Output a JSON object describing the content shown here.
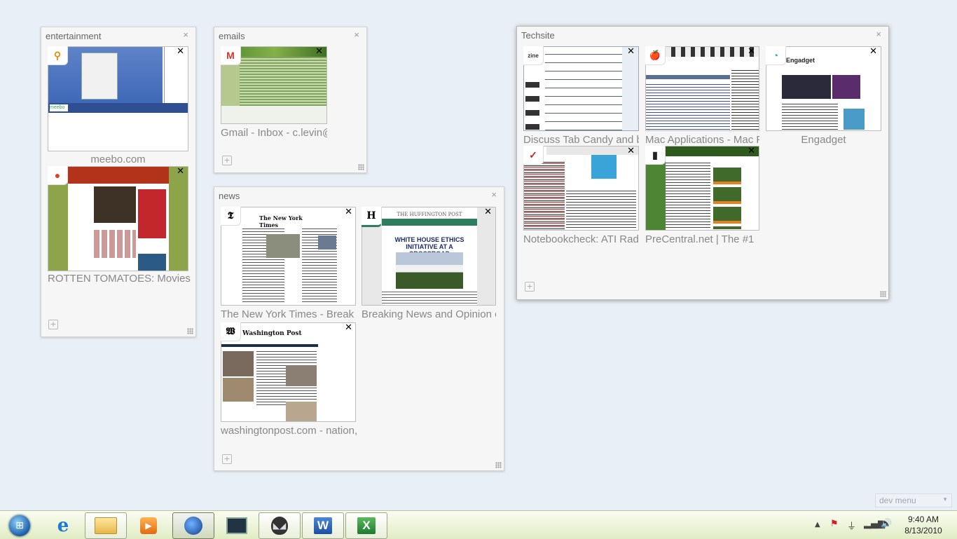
{
  "groups": {
    "entertainment": {
      "title": "entertainment",
      "tabs": [
        {
          "title": "meebo.com",
          "favicon": "meebo-icon"
        },
        {
          "title": "ROTTEN TOMATOES: Movies",
          "favicon": "tomato-icon"
        }
      ]
    },
    "emails": {
      "title": "emails",
      "tabs": [
        {
          "title": "Gmail - Inbox - c.levin@",
          "favicon": "gmail-icon",
          "fav_glyph": "M"
        }
      ]
    },
    "news": {
      "title": "news",
      "tabs": [
        {
          "title": "The New York Times - Break",
          "favicon": "nyt-icon",
          "fav_glyph": "𝕿",
          "masthead": "The New York Times"
        },
        {
          "title": "Breaking News and Opinion o",
          "favicon": "huffpost-icon",
          "fav_glyph": "H",
          "masthead": "THE HUFFINGTON POST",
          "headline": "WHITE HOUSE ETHICS INITIATIVE AT A CROSSROAD"
        },
        {
          "title": "washingtonpost.com - nation,",
          "favicon": "wapo-icon",
          "fav_glyph": "𝖂",
          "masthead": "Washington Post"
        }
      ]
    },
    "techsite": {
      "title": "Techsite",
      "tabs": [
        {
          "title": "Discuss Tab Candy and b",
          "favicon": "zine-icon",
          "fav_glyph": "zine"
        },
        {
          "title": "Mac Applications - Mac Fo",
          "favicon": "apple-icon",
          "fav_glyph": "🍎"
        },
        {
          "title": "Engadget",
          "favicon": "rss-icon",
          "fav_glyph": "◔"
        },
        {
          "title": "Notebookcheck: ATI Rad",
          "favicon": "notebookcheck-icon",
          "fav_glyph": "✓"
        },
        {
          "title": "PreCentral.net | The #1",
          "favicon": "precentral-icon",
          "fav_glyph": "▮"
        }
      ]
    }
  },
  "close_glyph": "×",
  "tab_close_glyph": "✕",
  "newtab_glyph": "+",
  "dev_menu": {
    "label": "dev menu"
  },
  "taskbar": {
    "items": [
      "Start",
      "Internet Explorer",
      "Windows Explorer",
      "Media Player",
      "Firefox Minefield",
      "System Monitor",
      "Alien App",
      "Microsoft Word",
      "Microsoft Excel"
    ]
  },
  "clock": {
    "time": "9:40 AM",
    "date": "8/13/2010"
  }
}
